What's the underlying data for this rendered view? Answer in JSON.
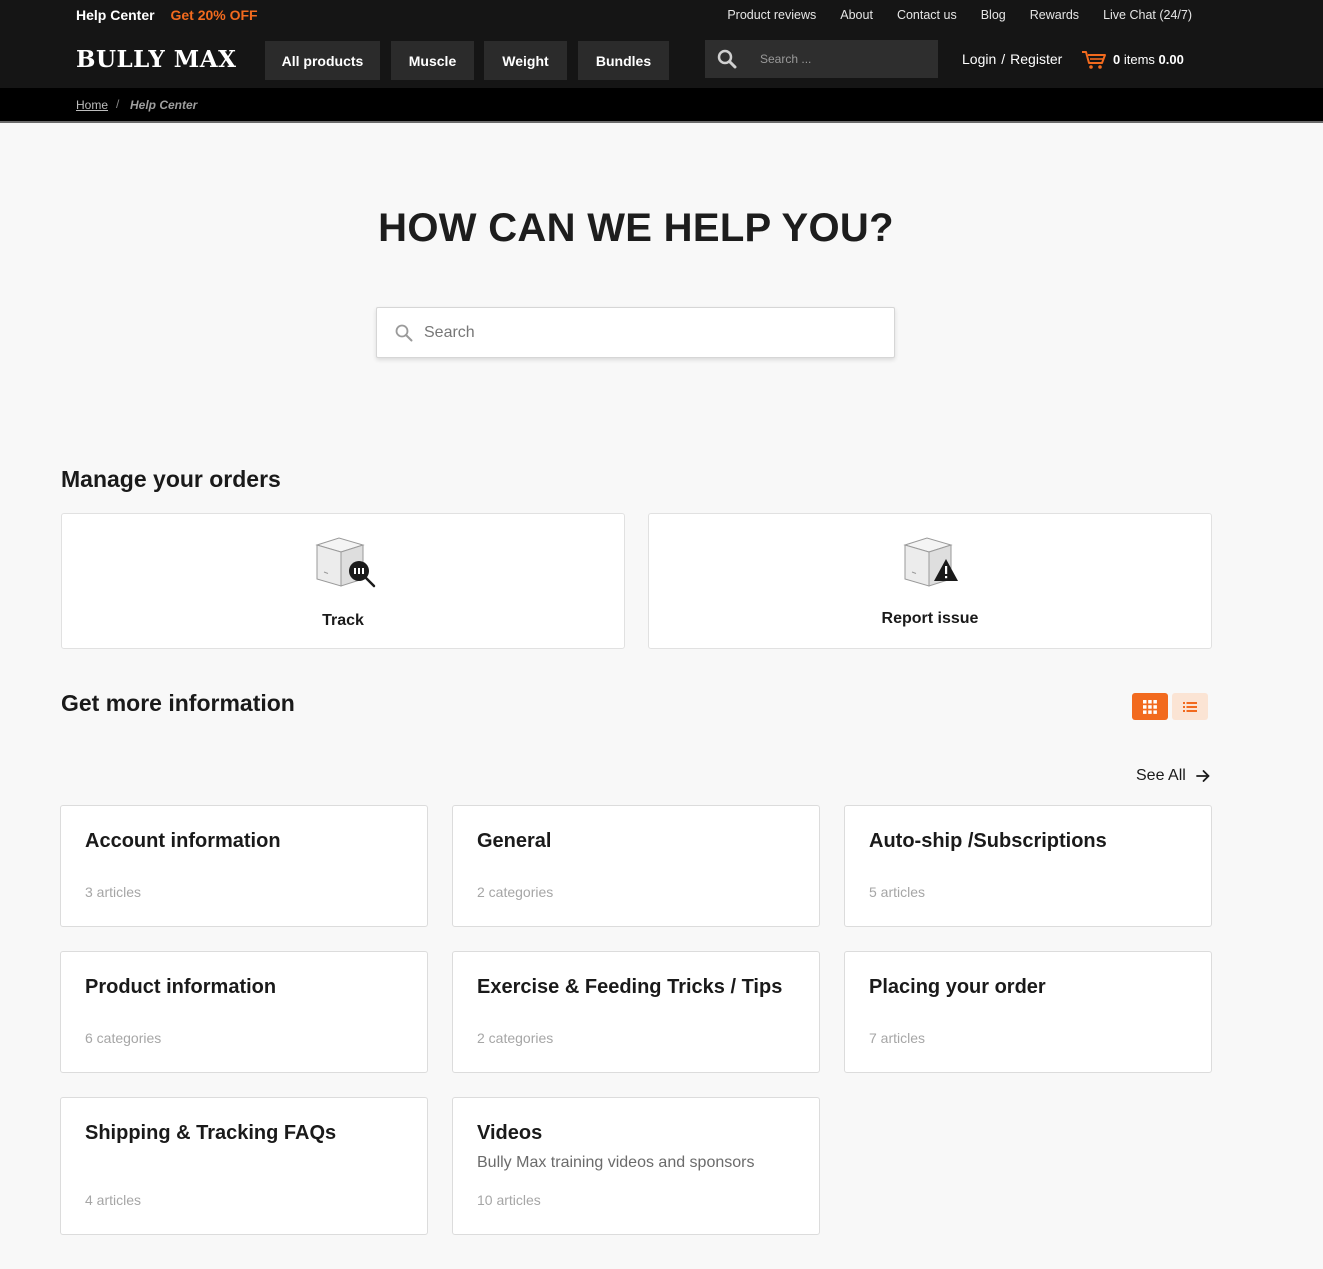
{
  "topbar": {
    "help_center": "Help Center",
    "promo": "Get 20% OFF",
    "links": [
      "Product reviews",
      "About",
      "Contact us",
      "Blog",
      "Rewards",
      "Live Chat (24/7)"
    ]
  },
  "header": {
    "logo": "BULLY MAX",
    "nav": [
      "All products",
      "Muscle",
      "Weight",
      "Bundles"
    ],
    "search_placeholder": "Search ...",
    "login": "Login",
    "login_sep": "/",
    "register": "Register",
    "cart_count": "0",
    "cart_items_label": "items",
    "cart_total": "0.00"
  },
  "breadcrumb": {
    "home": "Home",
    "separator": "/",
    "current": "Help Center"
  },
  "hero": {
    "title": "HOW CAN WE HELP YOU?",
    "search_placeholder": "Search"
  },
  "orders": {
    "title": "Manage your orders",
    "cards": [
      {
        "label": "Track",
        "icon": "box-search-icon"
      },
      {
        "label": "Report issue",
        "icon": "box-warning-icon"
      }
    ]
  },
  "info": {
    "title": "Get more information",
    "see_all": "See All",
    "categories": [
      {
        "title": "Account information",
        "description": "",
        "count": "3 articles"
      },
      {
        "title": "General",
        "description": "",
        "count": "2 categories"
      },
      {
        "title": "Auto-ship /Subscriptions",
        "description": "",
        "count": "5 articles"
      },
      {
        "title": "Product information",
        "description": "",
        "count": "6 categories"
      },
      {
        "title": "Exercise & Feeding Tricks / Tips",
        "description": "",
        "count": "2 categories"
      },
      {
        "title": "Placing your order",
        "description": "",
        "count": "7 articles"
      },
      {
        "title": "Shipping & Tracking FAQs",
        "description": "",
        "count": "4 articles"
      },
      {
        "title": "Videos",
        "description": "Bully Max training videos and sponsors",
        "count": "10 articles"
      }
    ]
  },
  "colors": {
    "accent": "#f26a1e",
    "header_bg": "#151515",
    "breadcrumb_bg": "#000000",
    "page_bg": "#f8f8f8"
  }
}
